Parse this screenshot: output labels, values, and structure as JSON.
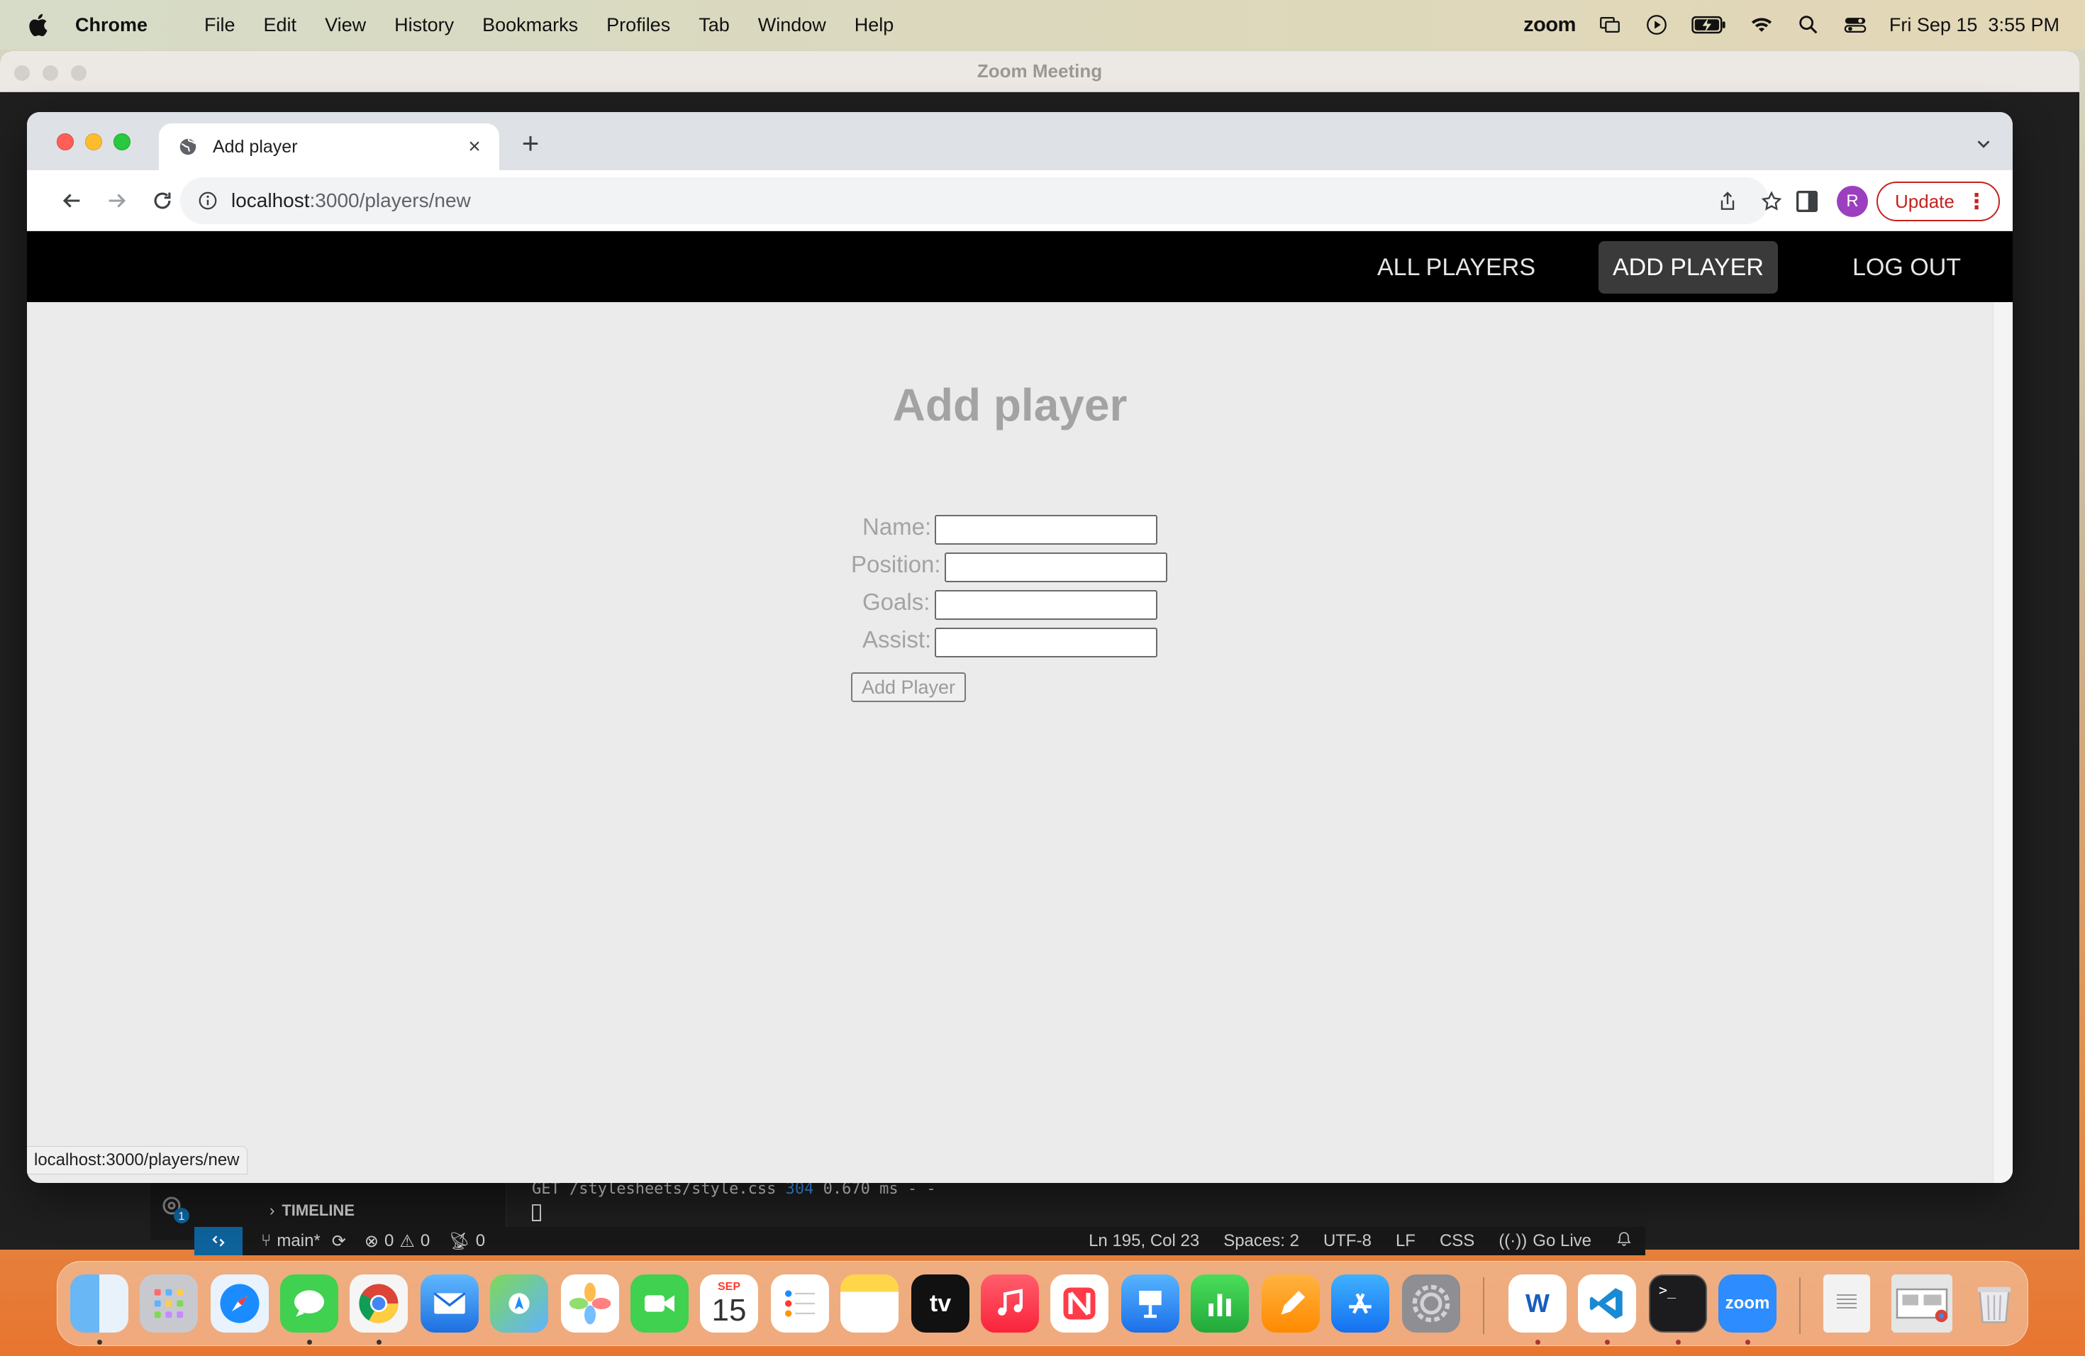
{
  "menubar": {
    "app_name": "Chrome",
    "items": [
      "File",
      "Edit",
      "View",
      "History",
      "Bookmarks",
      "Profiles",
      "Tab",
      "Window",
      "Help"
    ],
    "zoom_label": "zoom",
    "datetime": "Fri Sep 15  3:55 PM"
  },
  "zoom_window": {
    "title": "Zoom Meeting"
  },
  "chrome": {
    "tab_title": "Add player",
    "url_host": "localhost",
    "url_path": ":3000/players/new",
    "profile_initial": "R",
    "update_label": "Update",
    "status_url": "localhost:3000/players/new"
  },
  "site": {
    "nav": {
      "all_players": "ALL PLAYERS",
      "add_player": "ADD PLAYER",
      "log_out": "LOG OUT"
    },
    "page_title": "Add player",
    "form": {
      "name_label": "Name:",
      "position_label": "Position:",
      "goals_label": "Goals:",
      "assist_label": "Assist:",
      "name_value": "",
      "position_value": "",
      "goals_value": "",
      "assist_value": "",
      "submit_label": "Add Player"
    }
  },
  "vscode": {
    "timeline_label": "TIMELINE",
    "gear_badge": "1",
    "terminal_line_prefix": "GET /stylesheets/style.css ",
    "terminal_status": "304",
    "terminal_line_suffix": " 0.670 ms - -",
    "status": {
      "branch": "main*",
      "errors": "0",
      "warnings": "0",
      "ports": "0",
      "position": "Ln 195, Col 23",
      "spaces": "Spaces: 2",
      "encoding": "UTF-8",
      "eol": "LF",
      "language": "CSS",
      "go_live": "Go Live"
    }
  },
  "dock": {
    "calendar_month": "SEP",
    "calendar_day": "15",
    "tv_label": "tv",
    "zoom_label": "zoom",
    "word_label": "W"
  },
  "colors": {
    "site_nav_bg": "#000000",
    "site_nav_active": "#3a3a3a",
    "page_bg": "#ebebeb",
    "muted_text": "#a3a3a3",
    "update_red": "#c5221f"
  }
}
